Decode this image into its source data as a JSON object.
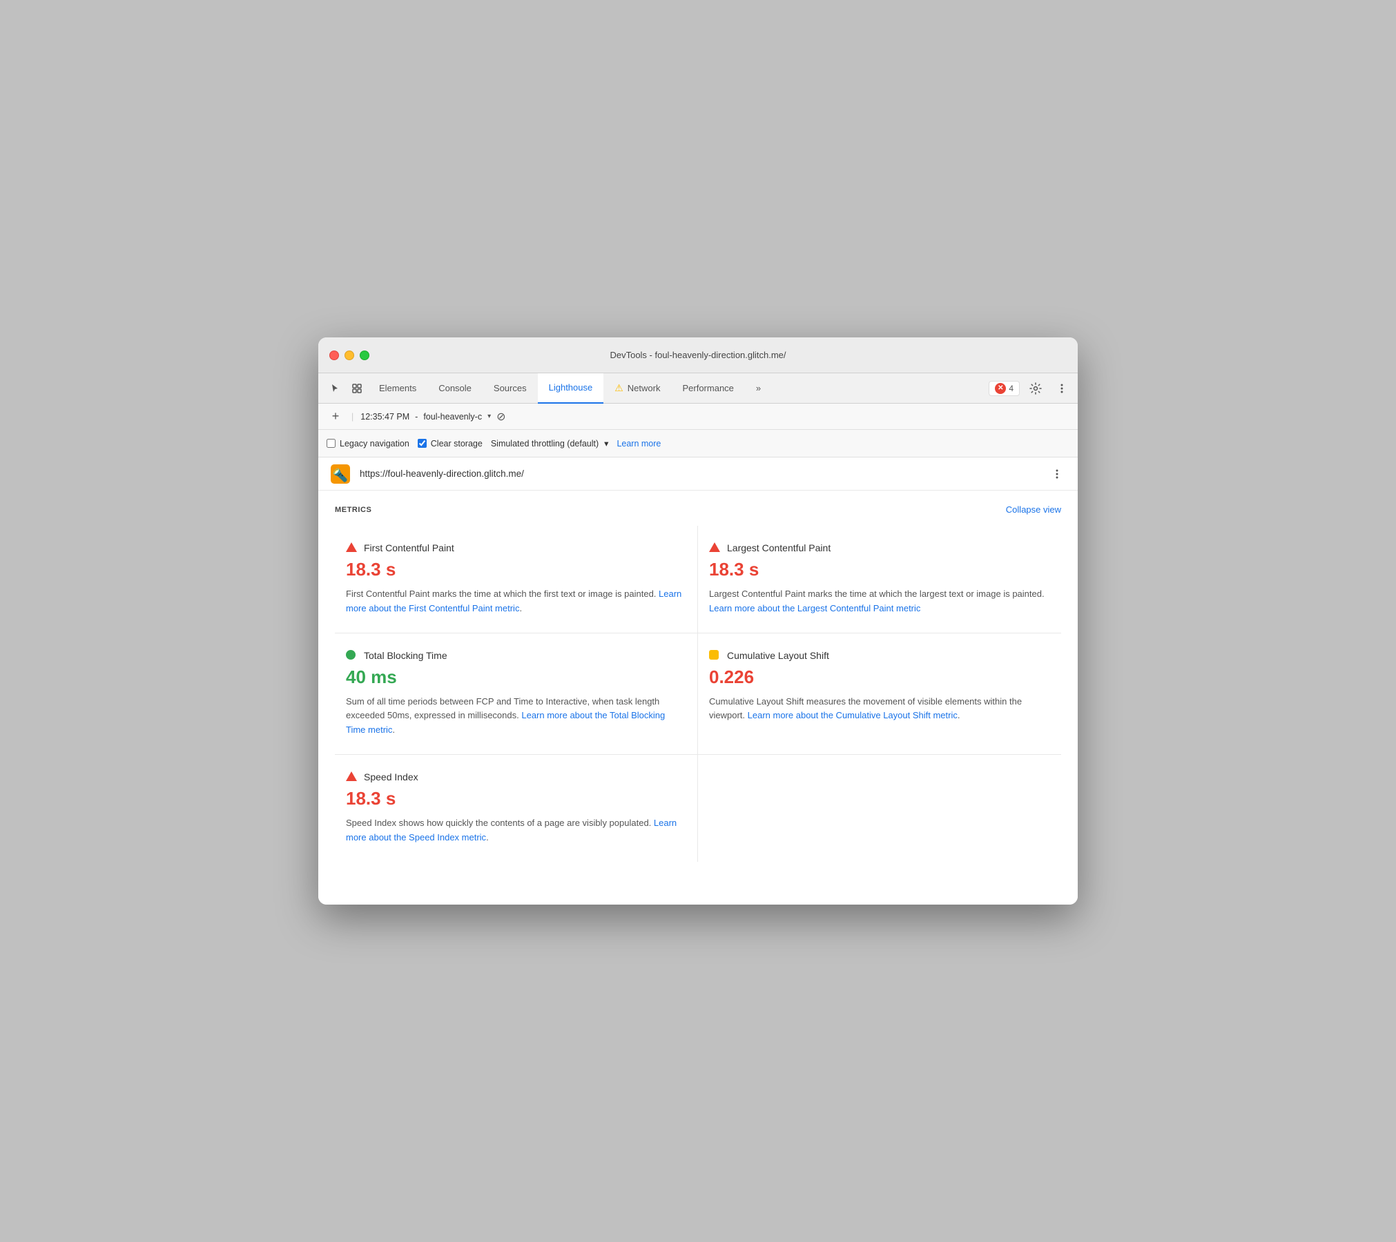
{
  "window": {
    "title": "DevTools - foul-heavenly-direction.glitch.me/"
  },
  "tabs": {
    "elements": "Elements",
    "console": "Console",
    "sources": "Sources",
    "lighthouse": "Lighthouse",
    "network": "Network",
    "performance": "Performance",
    "more": "»",
    "active": "lighthouse",
    "error_count": "4"
  },
  "toolbar": {
    "legacy_nav_label": "Legacy navigation",
    "clear_storage_label": "Clear storage",
    "throttling_label": "Simulated throttling (default)",
    "throttling_arrow": "▾",
    "learn_more": "Learn more"
  },
  "url_bar": {
    "url": "https://foul-heavenly-direction.glitch.me/"
  },
  "timestamp_bar": {
    "time": "12:35:47 PM",
    "domain": "foul-heavenly-c",
    "dropdown": "▾"
  },
  "metrics": {
    "title": "METRICS",
    "collapse_label": "Collapse view",
    "items": [
      {
        "id": "fcp",
        "name": "First Contentful Paint",
        "indicator": "red-triangle",
        "value": "18.3 s",
        "value_color": "red",
        "desc": "First Contentful Paint marks the time at which the first text or image is painted.",
        "link_text": "Learn more about the First Contentful Paint metric",
        "link_href": "#"
      },
      {
        "id": "lcp",
        "name": "Largest Contentful Paint",
        "indicator": "red-triangle",
        "value": "18.3 s",
        "value_color": "red",
        "desc": "Largest Contentful Paint marks the time at which the largest text or image is painted.",
        "link_text": "Learn more about the Largest Contentful Paint metric",
        "link_href": "#"
      },
      {
        "id": "tbt",
        "name": "Total Blocking Time",
        "indicator": "green-circle",
        "value": "40 ms",
        "value_color": "green",
        "desc": "Sum of all time periods between FCP and Time to Interactive, when task length exceeded 50ms, expressed in milliseconds.",
        "link_text": "Learn more about the Total Blocking Time metric",
        "link_href": "#"
      },
      {
        "id": "cls",
        "name": "Cumulative Layout Shift",
        "indicator": "orange-square",
        "value": "0.226",
        "value_color": "orange",
        "desc": "Cumulative Layout Shift measures the movement of visible elements within the viewport.",
        "link_text": "Learn more about the Cumulative Layout Shift metric",
        "link_href": "#"
      },
      {
        "id": "si",
        "name": "Speed Index",
        "indicator": "red-triangle",
        "value": "18.3 s",
        "value_color": "red",
        "desc": "Speed Index shows how quickly the contents of a page are visibly populated.",
        "link_text": "Learn more about the Speed Index metric",
        "link_href": "#"
      }
    ]
  }
}
